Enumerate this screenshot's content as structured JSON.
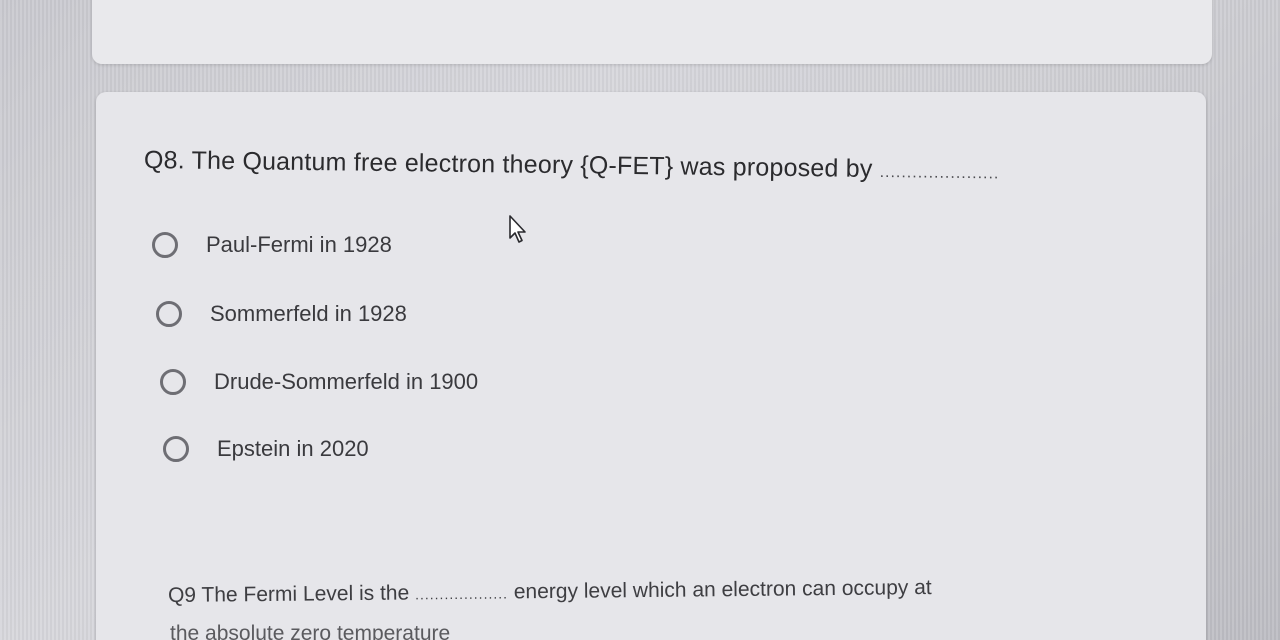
{
  "question_8": {
    "text": "Q8. The Quantum free electron theory {Q-FET} was proposed by",
    "blank": "......................"
  },
  "options": [
    {
      "label": "Paul-Fermi in 1928"
    },
    {
      "label": "Sommerfeld in 1928"
    },
    {
      "label": "Drude-Sommerfeld in 1900"
    },
    {
      "label": "Epstein in 2020"
    }
  ],
  "question_9": {
    "text_before": "Q9 The Fermi Level is the",
    "blank": "...................",
    "text_after": "energy level which an electron can occupy at",
    "line2": "the absolute zero temperature"
  },
  "cursor_icon": "arrow-pointer-icon"
}
